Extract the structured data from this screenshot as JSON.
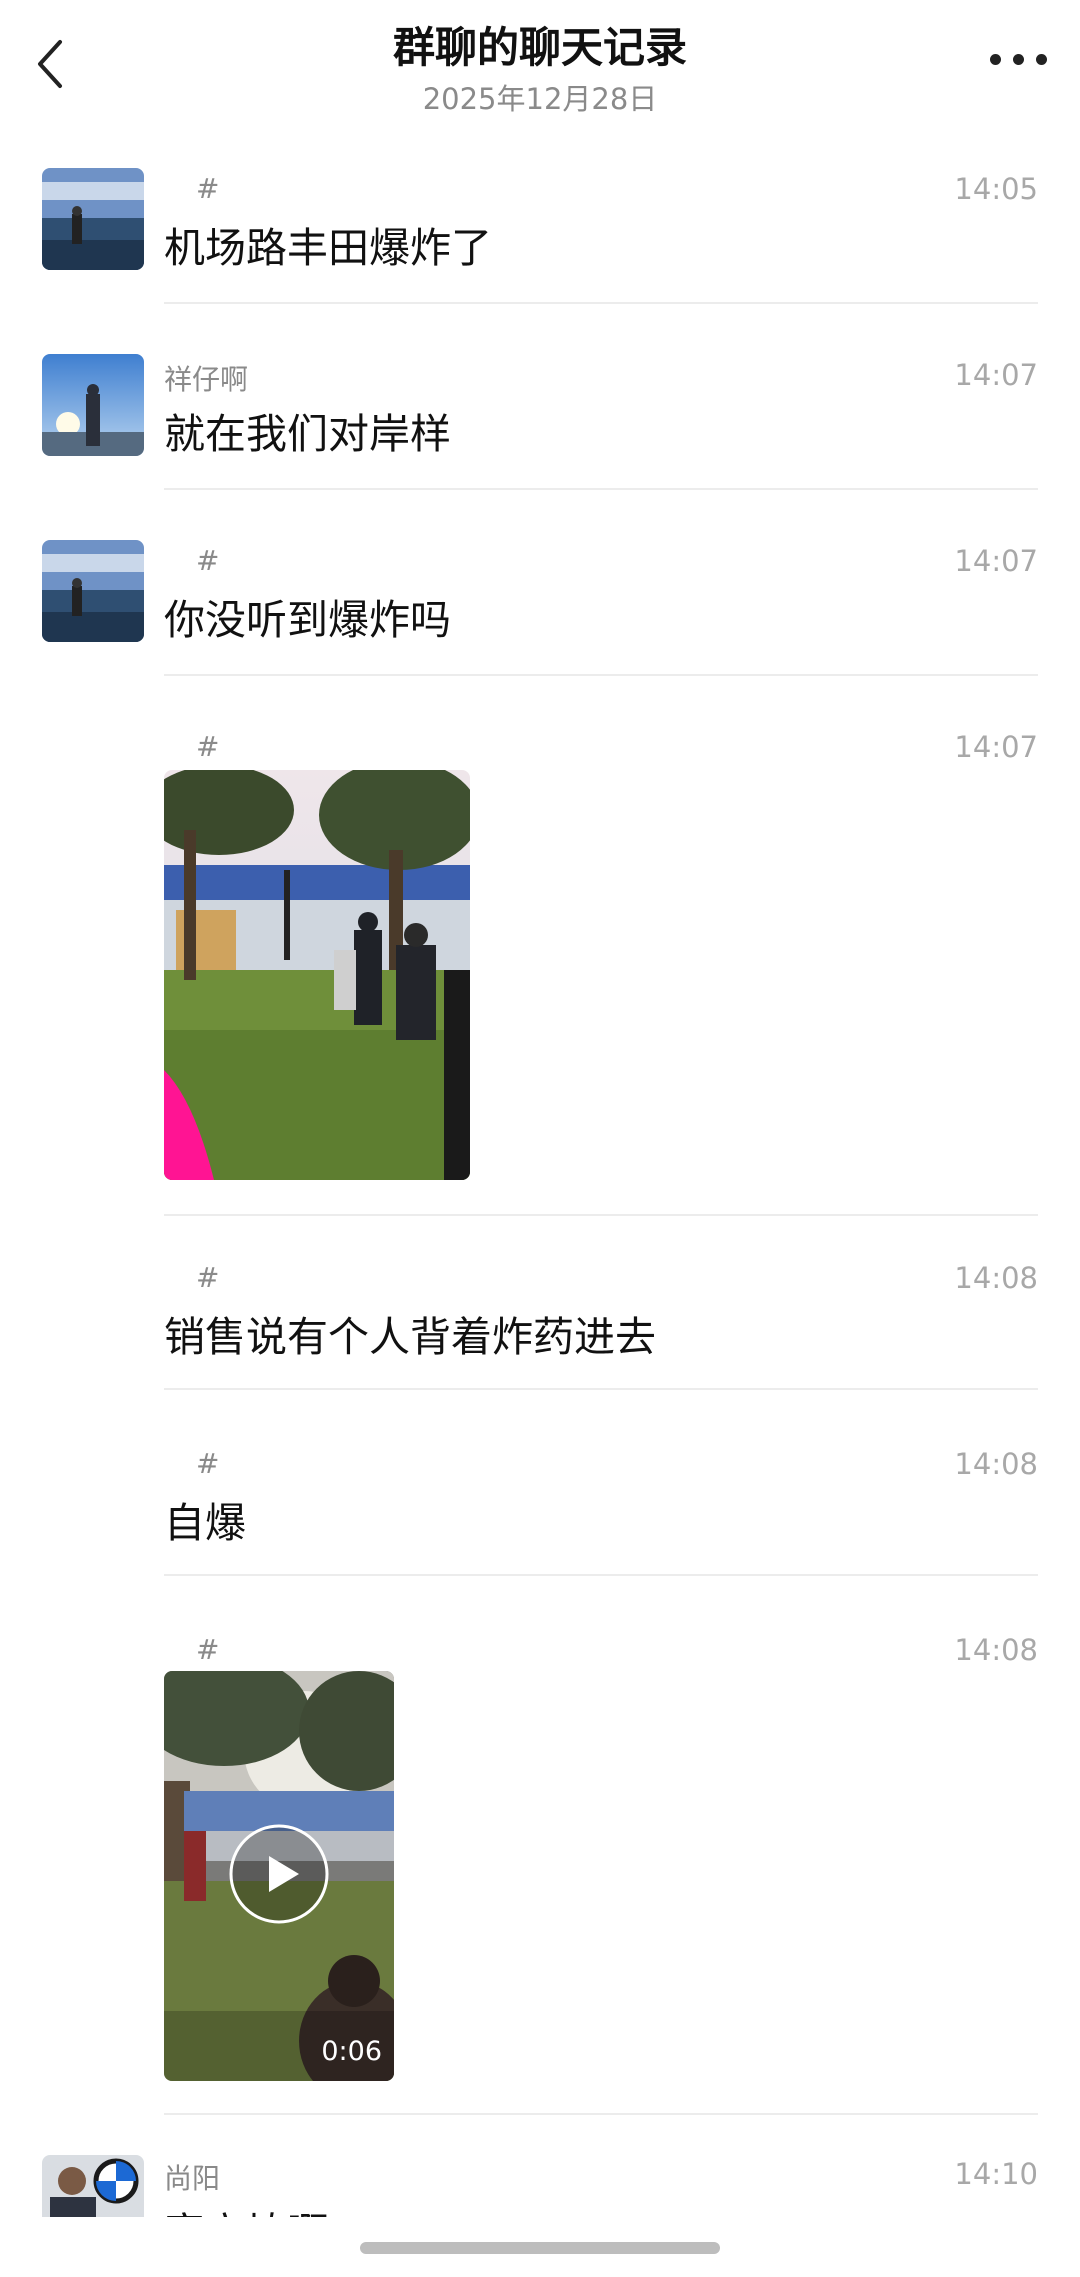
{
  "header": {
    "title": "群聊的聊天记录",
    "date": "2025年12月28日",
    "back_icon": "chevron-left-icon",
    "more_icon": "more-dots-icon"
  },
  "messages": [
    {
      "sender": "#",
      "time": "14:05",
      "text": "机场路丰田爆炸了"
    },
    {
      "sender": "祥仔啊",
      "time": "14:07",
      "text": "就在我们对岸样"
    },
    {
      "sender": "#",
      "time": "14:07",
      "text": "你没听到爆炸吗"
    },
    {
      "sender": "#",
      "time": "14:07",
      "media": "photo"
    },
    {
      "sender": "#",
      "time": "14:08",
      "text": "销售说有个人背着炸药进去"
    },
    {
      "sender": "#",
      "time": "14:08",
      "text": "自爆"
    },
    {
      "sender": "#",
      "time": "14:08",
      "media": "video",
      "duration": "0:06"
    },
    {
      "sender": "尚阳",
      "time": "14:10",
      "text": "寅立埴啊"
    }
  ],
  "colors": {
    "accent_pink": "#ff1493",
    "grass": "#6f8f3a",
    "text": "#111111",
    "meta": "#a8a8a8"
  }
}
